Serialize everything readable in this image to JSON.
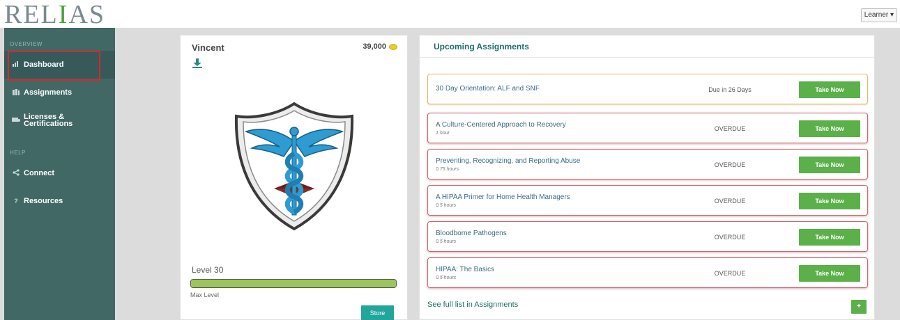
{
  "header": {
    "logo": {
      "part1": "REL",
      "accent": "I",
      "part2": "AS"
    },
    "user_menu": "Learner ▾"
  },
  "sidebar": {
    "sections": [
      {
        "label": "OVERVIEW"
      },
      {
        "label": "HELP"
      }
    ],
    "items": [
      {
        "label": "Dashboard",
        "icon": "bar-chart-icon",
        "active": true
      },
      {
        "label": "Assignments",
        "icon": "books-icon"
      },
      {
        "label": "Licenses &",
        "label2": "Certifications",
        "icon": "certificate-icon"
      },
      {
        "label": "Connect",
        "icon": "share-icon"
      },
      {
        "label": "Resources",
        "icon": "question-icon"
      }
    ]
  },
  "profile": {
    "name": "Vincent",
    "points": "39,000",
    "level": "Level 30",
    "progress_fraction": 1.0,
    "progress_caption": "Max Level",
    "store_label": "Store"
  },
  "assignments": {
    "title": "Upcoming Assignments",
    "take_now_label": "Take Now",
    "items": [
      {
        "title": "30 Day Orientation: ALF and SNF",
        "duration": "",
        "status": "Due in 26 Days",
        "kind": "due"
      },
      {
        "title": "A Culture-Centered Approach to Recovery",
        "duration": "1 hour",
        "status": "OVERDUE",
        "kind": "overdue"
      },
      {
        "title": "Preventing, Recognizing, and Reporting Abuse",
        "duration": "0.75 hours",
        "status": "OVERDUE",
        "kind": "overdue"
      },
      {
        "title": "A HIPAA Primer for Home Health Managers",
        "duration": "0.5 hours",
        "status": "OVERDUE",
        "kind": "overdue"
      },
      {
        "title": "Bloodborne Pathogens",
        "duration": "0.5 hours",
        "status": "OVERDUE",
        "kind": "overdue"
      },
      {
        "title": "HIPAA: The Basics",
        "duration": "0.5 hours",
        "status": "OVERDUE",
        "kind": "overdue"
      }
    ],
    "see_all": "See full list in Assignments",
    "plus_label": "+"
  },
  "colors": {
    "sidebar": "#416864",
    "accent_green": "#5bb04a",
    "teal": "#22a59a",
    "overdue_border": "#c9676d",
    "due_border": "#e2b96d"
  }
}
